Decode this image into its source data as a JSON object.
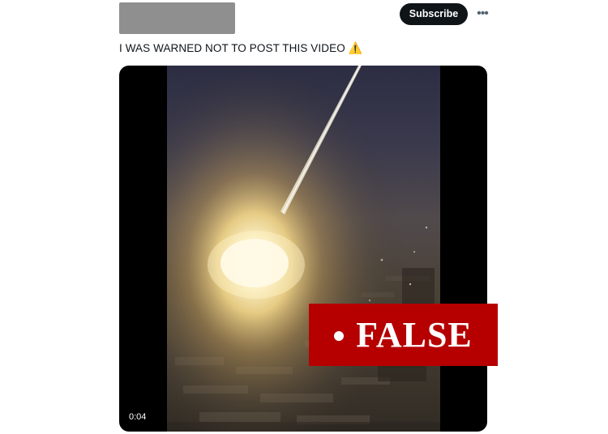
{
  "header": {
    "subscribe_label": "Subscribe",
    "more_icon": "more-horizontal-icon"
  },
  "tweet": {
    "text": "I WAS WARNED NOT TO POST THIS VIDEO",
    "emoji": "⚠️"
  },
  "video": {
    "duration": "0:04"
  },
  "stamp": {
    "label": "FALSE",
    "color": "#b60000"
  }
}
